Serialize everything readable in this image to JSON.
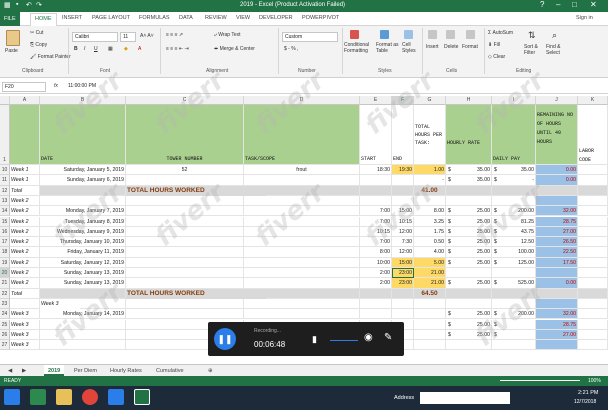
{
  "window": {
    "title": "2019 - Excel (Product Activation Failed)",
    "signin": "Sign in",
    "help": "?"
  },
  "tabs": [
    "FILE",
    "HOME",
    "INSERT",
    "PAGE LAYOUT",
    "FORMULAS",
    "DATA",
    "REVIEW",
    "VIEW",
    "DEVELOPER",
    "POWERPIVOT"
  ],
  "ribbon": {
    "clipboard": {
      "paste": "Paste",
      "cut": "Cut",
      "copy": "Copy",
      "format_painter": "Format Painter",
      "group": "Clipboard"
    },
    "font": {
      "name": "Calibri",
      "size": "11",
      "group": "Font"
    },
    "alignment": {
      "wrap": "Wrap Text",
      "merge": "Merge & Center",
      "group": "Alignment"
    },
    "number": {
      "format": "Custom",
      "symbols": "$ - % ,",
      "group": "Number"
    },
    "styles": {
      "cond": "Conditional Formatting",
      "table": "Format as Table",
      "cell": "Cell Styles",
      "group": "Styles"
    },
    "cells": {
      "insert": "Insert",
      "delete": "Delete",
      "format": "Format",
      "group": "Cells"
    },
    "editing": {
      "autosum": "AutoSum",
      "fill": "Fill",
      "clear": "Clear",
      "sort": "Sort & Filter",
      "find": "Find & Select",
      "group": "Editing"
    }
  },
  "formula_bar": {
    "name_box": "F20",
    "fx": "fx",
    "value": "11:00:00 PM"
  },
  "columns": [
    "A",
    "B",
    "C",
    "D",
    "E",
    "F",
    "G",
    "H",
    "I",
    "J",
    "K"
  ],
  "header_row": {
    "row": "1",
    "date": "DATE",
    "tower": "TOWER NUMBER",
    "task": "TASK/SCOPE",
    "start": "START",
    "end": "END",
    "total": "TOTAL HOURS PER TASK:",
    "hourly": "HOURLY RATE",
    "daily": "DAILY PAY",
    "remaining": "REMAINING NO OF HOURS UNTIL 40 HOURS",
    "labor": "LABOR CODE"
  },
  "rows": [
    {
      "n": "10",
      "a": "Week 1",
      "b": "Saturday, January 5, 2019",
      "c": "52",
      "d": "frout",
      "e": "18:30",
      "f": "19:30",
      "g": "1.00",
      "h1": "$",
      "h": "35.00",
      "i1": "$",
      "i": "35.00",
      "j": "0.00"
    },
    {
      "n": "11",
      "a": "Week 1",
      "b": "Sunday, January 6, 2019",
      "c": "",
      "d": "",
      "e": "",
      "f": "",
      "g": "-",
      "h1": "$",
      "h": "35.00",
      "i1": "$",
      "i": "-",
      "j": "0.00"
    },
    {
      "n": "12",
      "a": "Total",
      "b": "",
      "c": "",
      "d": "",
      "e": "",
      "f": "",
      "g": "",
      "h1": "",
      "h": "",
      "i1": "",
      "i": "",
      "j": "",
      "total_label": "TOTAL HOURS WORKED",
      "total_value": "41.00"
    },
    {
      "n": "13",
      "a": "Week 2",
      "b": "",
      "c": "",
      "d": "",
      "e": "",
      "f": "",
      "g": "",
      "h1": "",
      "h": "",
      "i1": "",
      "i": "",
      "j": ""
    },
    {
      "n": "14",
      "a": "Week 2",
      "b": "Monday, January 7, 2019",
      "c": "",
      "d": "",
      "e": "7:00",
      "f": "15:00",
      "g": "8.00",
      "h1": "$",
      "h": "25.00",
      "i1": "$",
      "i": "200.00",
      "j": "32.00"
    },
    {
      "n": "15",
      "a": "Week 2",
      "b": "Tuesday, January 8, 2019",
      "c": "",
      "d": "",
      "e": "7:00",
      "f": "10:15",
      "g": "3.25",
      "h1": "$",
      "h": "25.00",
      "i1": "$",
      "i": "81.25",
      "j": "28.75"
    },
    {
      "n": "16",
      "a": "Week 2",
      "b": "Wednesday, January 9, 2019",
      "c": "",
      "d": "",
      "e": "10:15",
      "f": "12:00",
      "g": "1.75",
      "h1": "$",
      "h": "25.00",
      "i1": "$",
      "i": "43.75",
      "j": "27.00"
    },
    {
      "n": "17",
      "a": "Week 2",
      "b": "Thursday, January 10, 2019",
      "c": "",
      "d": "",
      "e": "7:00",
      "f": "7:30",
      "g": "0.50",
      "h1": "$",
      "h": "25.00",
      "i1": "$",
      "i": "12.50",
      "j": "26.50"
    },
    {
      "n": "18",
      "a": "Week 2",
      "b": "Friday, January 11, 2019",
      "c": "",
      "d": "",
      "e": "8:00",
      "f": "12:00",
      "g": "4.00",
      "h1": "$",
      "h": "25.00",
      "i1": "$",
      "i": "100.00",
      "j": "22.50"
    },
    {
      "n": "19",
      "a": "Week 2",
      "b": "Saturday, January 12, 2019",
      "c": "",
      "d": "",
      "e": "10:00",
      "f": "15:00",
      "g": "5.00",
      "h1": "$",
      "h": "25.00",
      "i1": "$",
      "i": "125.00",
      "j": "17.50"
    },
    {
      "n": "20",
      "a": "Week 2",
      "b": "Sunday, January 13, 2019",
      "c": "",
      "d": "",
      "e": "2:00",
      "f": "23:00",
      "g": "21.00",
      "h1": "",
      "h": "",
      "i1": "",
      "i": "",
      "j": ""
    },
    {
      "n": "21",
      "a": "Week 2",
      "b": "Sunday, January 13, 2019",
      "c": "",
      "d": "",
      "e": "2:00",
      "f": "23:00",
      "g": "21.00",
      "h1": "$",
      "h": "25.00",
      "i1": "$",
      "i": "525.00",
      "j": "0.00"
    },
    {
      "n": "22",
      "a": "Total",
      "b": "",
      "c": "",
      "d": "",
      "e": "",
      "f": "",
      "g": "",
      "h1": "",
      "h": "",
      "i1": "",
      "i": "",
      "j": "",
      "total_label": "TOTAL HOURS WORKED",
      "total_value": "64.50"
    },
    {
      "n": "23",
      "a": "",
      "b": "",
      "c": "",
      "d": "",
      "e": "",
      "f": "",
      "g": "",
      "h1": "",
      "h": "",
      "i1": "",
      "i": "",
      "j": "",
      "week_label": "Week 3"
    },
    {
      "n": "24",
      "a": "Week 3",
      "b": "Monday, January 14, 2019",
      "c": "",
      "d": "",
      "e": "",
      "f": "",
      "g": "",
      "h1": "$",
      "h": "25.00",
      "i1": "$",
      "i": "200.00",
      "j": "32.00"
    },
    {
      "n": "25",
      "a": "Week 3",
      "b": "",
      "c": "",
      "d": "",
      "e": "",
      "f": "",
      "g": "",
      "h1": "$",
      "h": "25.00",
      "i1": "$",
      "i": "",
      "j": "28.75"
    },
    {
      "n": "26",
      "a": "Week 3",
      "b": "",
      "c": "",
      "d": "",
      "e": "",
      "f": "",
      "g": "",
      "h1": "$",
      "h": "25.00",
      "i1": "$",
      "i": "",
      "j": "27.00"
    },
    {
      "n": "27",
      "a": "Week 3",
      "b": "",
      "c": "",
      "d": "",
      "e": "",
      "f": "",
      "g": "",
      "h1": "",
      "h": "",
      "i1": "",
      "i": "",
      "j": ""
    }
  ],
  "sheets": [
    "2019",
    "Per Diem",
    "Hourly Rates",
    "Cumulative"
  ],
  "status": {
    "left": "READY",
    "zoom": "100%"
  },
  "recorder": {
    "label": "Recording...",
    "time": "00:06:48"
  },
  "taskbar": {
    "address": "Address",
    "time": "2:21 PM",
    "date": "12/7/2018"
  },
  "watermark": "fiverr",
  "colors": {
    "excel_green": "#217346",
    "header_green": "#a9d08e",
    "highlight_yellow": "#ffd966",
    "remaining_blue": "#9bc2e6"
  }
}
